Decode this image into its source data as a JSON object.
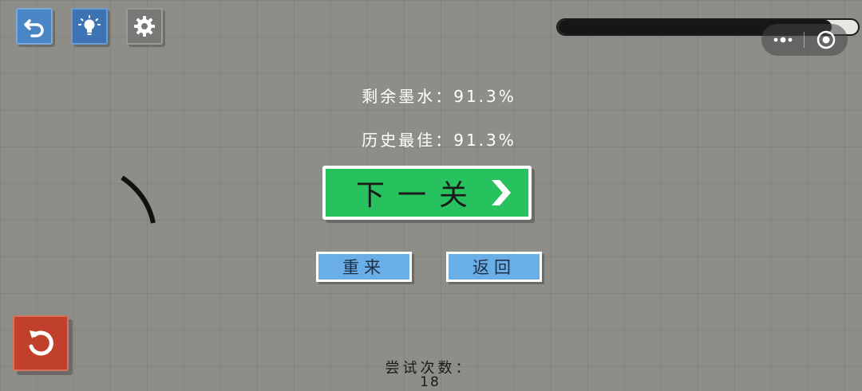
{
  "toolbar": {
    "back_icon": "undo-arrow-icon",
    "hint_icon": "lightbulb-icon",
    "settings_icon": "gear-icon"
  },
  "ink_meter": {
    "fraction": 0.913
  },
  "miniprogram_capsule": {
    "more_icon": "more-dots-icon",
    "close_icon": "target-close-icon"
  },
  "result": {
    "ink_line": "剩余墨水：91.3%",
    "best_line": "历史最佳：91.3%",
    "next_label": "下一关",
    "retry_label": "重来",
    "return_label": "返回"
  },
  "attempts": {
    "label": "尝试次数：",
    "value": "18"
  },
  "restart_icon": "restart-icon",
  "colors": {
    "background": "#8f8d87",
    "next_button": "#27c25e",
    "small_button": "#6aaee8",
    "restart_button": "#c0402c",
    "toolbar_blue": "#4a86c5",
    "ink": "#161616"
  }
}
